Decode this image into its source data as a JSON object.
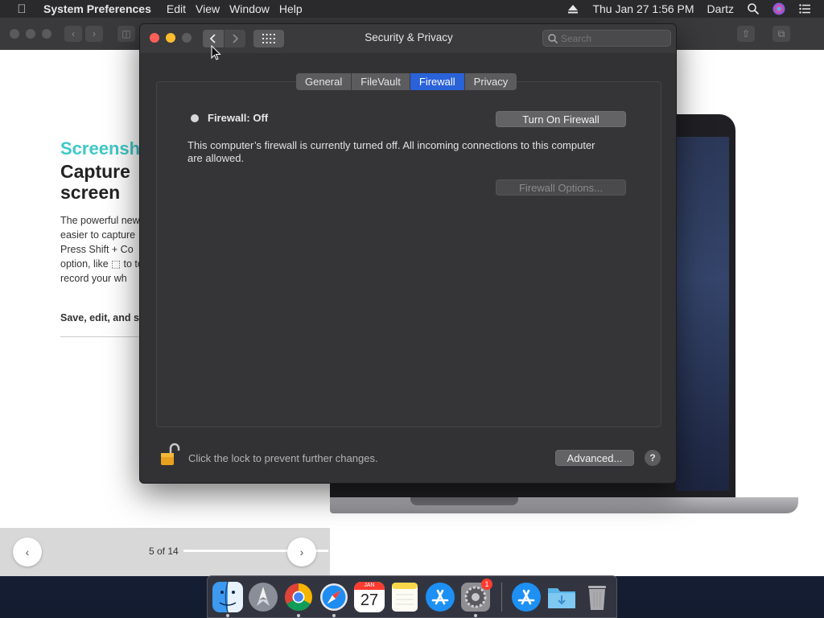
{
  "menubar": {
    "app": "System Preferences",
    "items": [
      "Edit",
      "View",
      "Window",
      "Help"
    ],
    "clock": "Thu Jan 27  1:56 PM",
    "user": "Dartz"
  },
  "background_app": {
    "heading1": "Screensh",
    "heading2": "Capture screen",
    "body": "The powerful new easier to capture Press Shift + Co option, like ⬚ to to record your wh",
    "save": "Save, edit, and s",
    "pagination": "5 of 14"
  },
  "window": {
    "title": "Security & Privacy",
    "search_placeholder": "Search",
    "tabs": [
      {
        "label": "General",
        "active": false
      },
      {
        "label": "FileVault",
        "active": false
      },
      {
        "label": "Firewall",
        "active": true
      },
      {
        "label": "Privacy",
        "active": false
      }
    ],
    "firewall_status": "Firewall: Off",
    "turn_on_button": "Turn On Firewall",
    "description": "This computer’s firewall is currently turned off. All incoming connections to this computer are allowed.",
    "options_button": "Firewall Options...",
    "lock_text": "Click the lock to prevent further changes.",
    "advanced_button": "Advanced...",
    "help_label": "?"
  },
  "dock": {
    "calendar_month": "JAN",
    "calendar_day": "27",
    "badge_count": "1"
  },
  "colors": {
    "accent": "#2a62d8",
    "close": "#ff5f57",
    "minimize": "#febc2e",
    "badge": "#ff3b30"
  }
}
